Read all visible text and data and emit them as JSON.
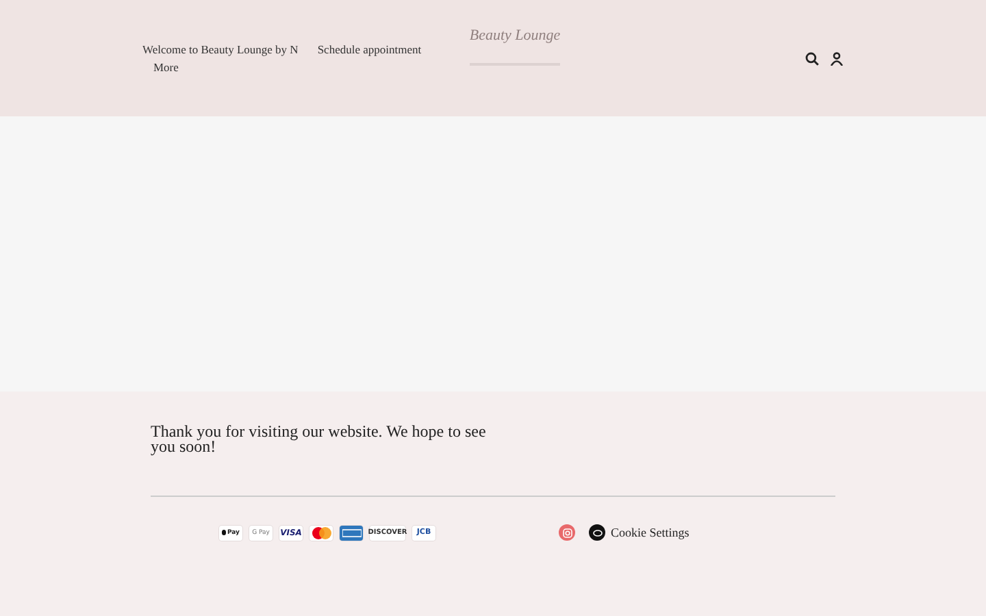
{
  "header": {
    "nav": [
      {
        "label": "Welcome to Beauty Lounge by N"
      },
      {
        "label": "Schedule appointment"
      },
      {
        "label": "More"
      }
    ],
    "logo": {
      "text": "Beauty Lounge"
    }
  },
  "footer": {
    "message": "Thank you for visiting our website. We hope to see you soon!",
    "payments": [
      {
        "kind": "apple",
        "label": "Pay"
      },
      {
        "kind": "google",
        "label": "G Pay"
      },
      {
        "kind": "visa",
        "label": "VISA"
      },
      {
        "kind": "mastercard"
      },
      {
        "kind": "amex"
      },
      {
        "kind": "discover",
        "label": "DISCOVER"
      },
      {
        "kind": "jcb",
        "label": "JCB"
      }
    ],
    "social": [
      {
        "kind": "instagram",
        "color": "#e8696b"
      }
    ],
    "cookie_settings": {
      "label": "Cookie Settings"
    }
  }
}
